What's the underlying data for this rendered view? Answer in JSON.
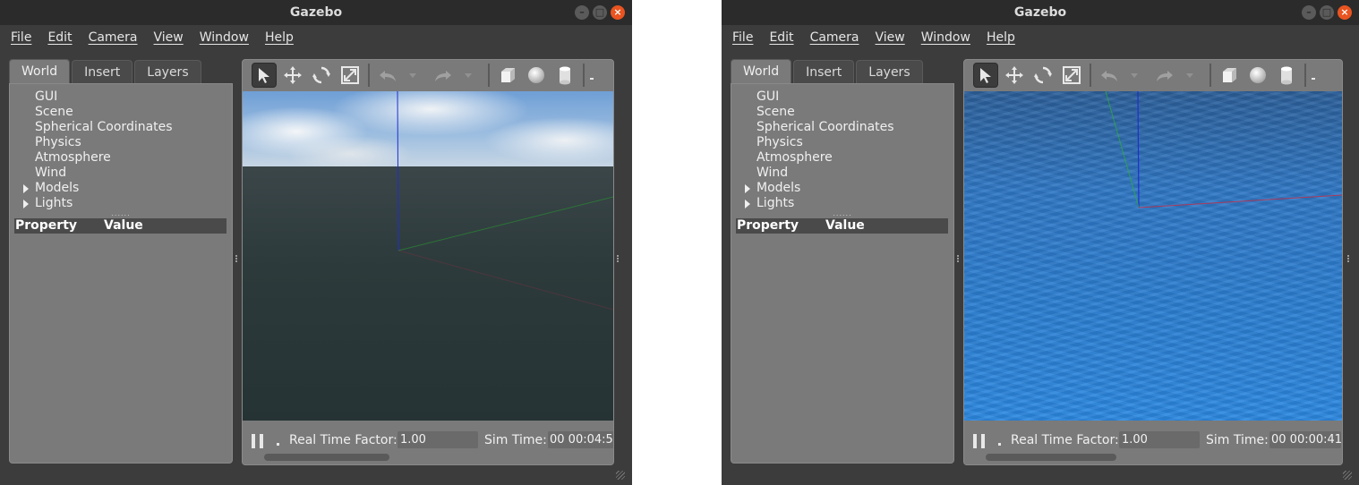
{
  "windows": [
    {
      "title": "Gazebo",
      "window_buttons": [
        "–",
        "□",
        "×"
      ],
      "menu": [
        "File",
        "Edit",
        "Camera",
        "View",
        "Window",
        "Help"
      ],
      "tabs": [
        "World",
        "Insert",
        "Layers"
      ],
      "active_tab": "World",
      "tree": [
        "GUI",
        "Scene",
        "Spherical Coordinates",
        "Physics",
        "Atmosphere",
        "Wind",
        "Models",
        "Lights"
      ],
      "property_header": {
        "property": "Property",
        "value": "Value"
      },
      "status": {
        "real_time_factor_label": "Real Time Factor:",
        "real_time_factor": "1.00",
        "sim_time_label": "Sim Time:",
        "sim_time": "00 00:04:5"
      },
      "icons": [
        "arrow-select-icon",
        "translate-icon",
        "rotate-icon",
        "scale-icon",
        "undo-icon",
        "redo-icon",
        "box-icon",
        "sphere-icon",
        "cylinder-icon"
      ],
      "scene": "dark-ocean-with-sky"
    },
    {
      "title": "Gazebo",
      "window_buttons": [
        "–",
        "□",
        "×"
      ],
      "menu": [
        "File",
        "Edit",
        "Camera",
        "View",
        "Window",
        "Help"
      ],
      "tabs": [
        "World",
        "Insert",
        "Layers"
      ],
      "active_tab": "World",
      "tree": [
        "GUI",
        "Scene",
        "Spherical Coordinates",
        "Physics",
        "Atmosphere",
        "Wind",
        "Models",
        "Lights"
      ],
      "property_header": {
        "property": "Property",
        "value": "Value"
      },
      "status": {
        "real_time_factor_label": "Real Time Factor:",
        "real_time_factor": "1.00",
        "sim_time_label": "Sim Time:",
        "sim_time": "00 00:00:41"
      },
      "icons": [
        "arrow-select-icon",
        "translate-icon",
        "rotate-icon",
        "scale-icon",
        "undo-icon",
        "redo-icon",
        "box-icon",
        "sphere-icon",
        "cylinder-icon"
      ],
      "scene": "blue-ocean"
    }
  ],
  "colors": {
    "titlebar": "#2b2b2b",
    "window_bg": "#3c3c3c",
    "panel_bg": "#7a7a7a",
    "close_button": "#e95420",
    "dark_water": "#2c3a3b",
    "blue_water": "#2b7fd3",
    "axis_x": "#c0304a",
    "axis_y": "#2faa3a",
    "axis_z": "#1f2fd0"
  }
}
